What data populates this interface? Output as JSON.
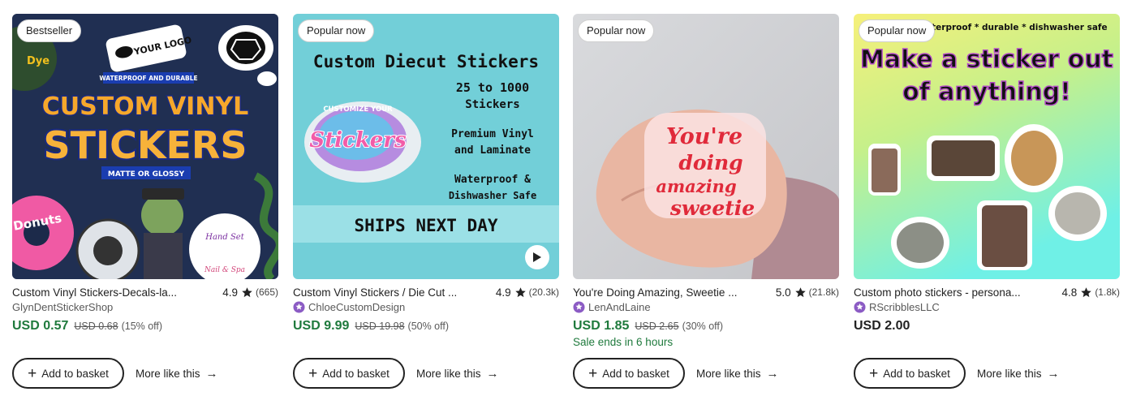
{
  "cards": [
    {
      "badge": "Bestseller",
      "title": "Custom Vinyl Stickers-Decals-la...",
      "rating": "4.9",
      "reviews": "(665)",
      "shop": "GlynDentStickerShop",
      "price": "USD 0.57",
      "original_price": "USD 0.68",
      "discount": "(15% off)",
      "add_label": "Add to basket",
      "more_label": "More like this",
      "image": {
        "texts": [
          "YOUR LOGO",
          "WATERPROOF AND DURABLE",
          "CUSTOM VINYL",
          "STICKERS",
          "MATTE OR GLOSSY",
          "Donuts",
          "Hand Set",
          "Nail & Spa",
          "Dye"
        ]
      }
    },
    {
      "badge": "Popular now",
      "title": "Custom Vinyl Stickers / Die Cut ...",
      "rating": "4.9",
      "reviews": "(20.3k)",
      "shop": "ChloeCustomDesign",
      "price": "USD 9.99",
      "original_price": "USD 19.98",
      "discount": "(50% off)",
      "add_label": "Add to basket",
      "more_label": "More like this",
      "image": {
        "heading": "Custom Diecut Stickers",
        "line1": "25 to 1000",
        "line2": "Stickers",
        "line3": "Premium Vinyl",
        "line4": "and Laminate",
        "line5": "Waterproof &",
        "line6": "Dishwasher Safe",
        "sticker_top": "CUSTOMIZE YOUR",
        "sticker_main": "Stickers",
        "banner": "SHIPS NEXT DAY"
      }
    },
    {
      "badge": "Popular now",
      "title": "You're Doing Amazing, Sweetie ...",
      "rating": "5.0",
      "reviews": "(21.8k)",
      "shop": "LenAndLaine",
      "price": "USD 1.85",
      "original_price": "USD 2.65",
      "discount": "(30% off)",
      "sale_note": "Sale ends in 6 hours",
      "add_label": "Add to basket",
      "more_label": "More like this",
      "image": {
        "l1": "You're",
        "l2": "doing",
        "l3": "amazing",
        "l4": "sweetie"
      }
    },
    {
      "badge": "Popular now",
      "title": "Custom photo stickers - persona...",
      "rating": "4.8",
      "reviews": "(1.8k)",
      "shop": "RScribblesLLC",
      "price": "USD 2.00",
      "add_label": "Add to basket",
      "more_label": "More like this",
      "image": {
        "top": "waterproof * durable * dishwasher safe",
        "heading1": "Make a sticker out",
        "heading2": "of anything!"
      }
    }
  ],
  "colors": {
    "sale_price": "#1f7a3d",
    "star_seller": "#8b5bc4",
    "text": "#222222",
    "muted": "#595959"
  },
  "icons": {
    "rating": "star-icon",
    "seller": "star-seller-icon",
    "add": "plus-icon",
    "more": "arrow-right-icon",
    "video": "play-icon"
  }
}
